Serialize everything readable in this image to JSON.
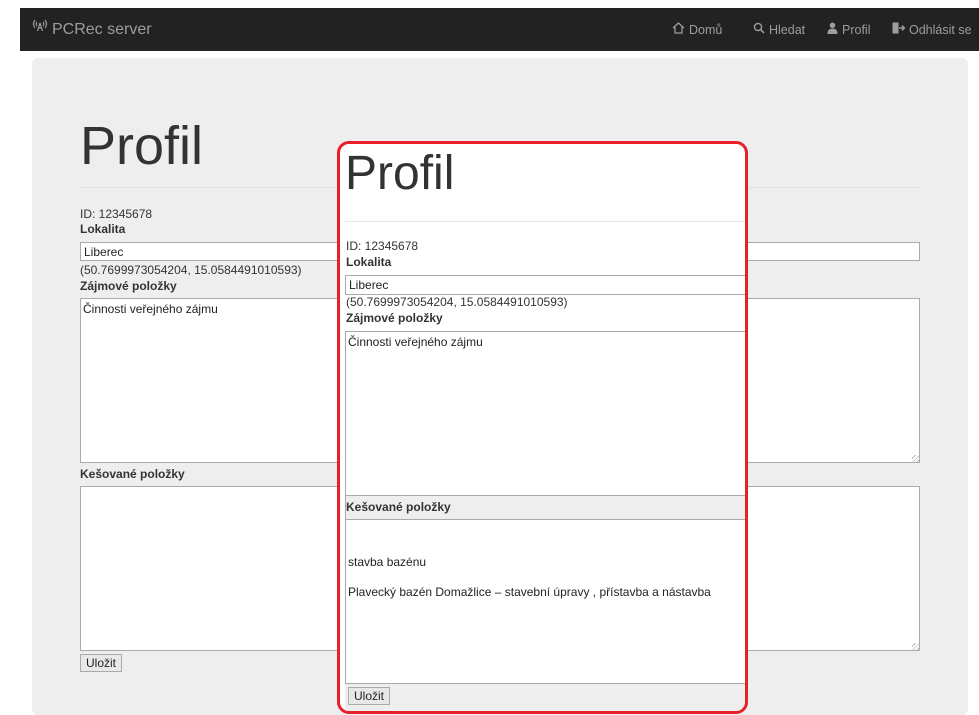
{
  "navbar": {
    "brand": "PCRec server",
    "brand_icon": "broadcast-icon",
    "items": [
      {
        "label": "Domů",
        "icon": "home-icon"
      },
      {
        "label": "Hledat",
        "icon": "search-icon"
      },
      {
        "label": "Profil",
        "icon": "user-icon"
      },
      {
        "label": "Odhlásit se",
        "icon": "logout-icon"
      }
    ]
  },
  "profile": {
    "title": "Profil",
    "id_text": "ID: 12345678",
    "location_label": "Lokalita",
    "location_value": "Liberec",
    "coordinates": "(50.7699973054204, 15.0584491010593)",
    "interests_label": "Zájmové položky",
    "interests_value": "Činnosti veřejného zájmu",
    "cached_label": "Kešované položky",
    "cached_value": "",
    "save_button": "Uložit"
  },
  "zoomed": {
    "title": "Profil",
    "id_text": "ID: 12345678",
    "location_label": "Lokalita",
    "location_value": "Liberec",
    "coordinates": "(50.7699973054204, 15.0584491010593)",
    "interests_label": "Zájmové položky",
    "interests_value": "Činnosti veřejného zájmu",
    "cached_label": "Kešované položky",
    "cached_lines": [
      "stavba bazénu",
      "Plavecký bazén Domažlice – stavební úpravy , přístavba a nástavba"
    ],
    "save_button": "Uložit"
  },
  "colors": {
    "navbar_bg": "#222222",
    "navbar_text": "#9d9d9d",
    "jumbotron_bg": "#eeeeee",
    "callout_border": "#e8202a"
  }
}
